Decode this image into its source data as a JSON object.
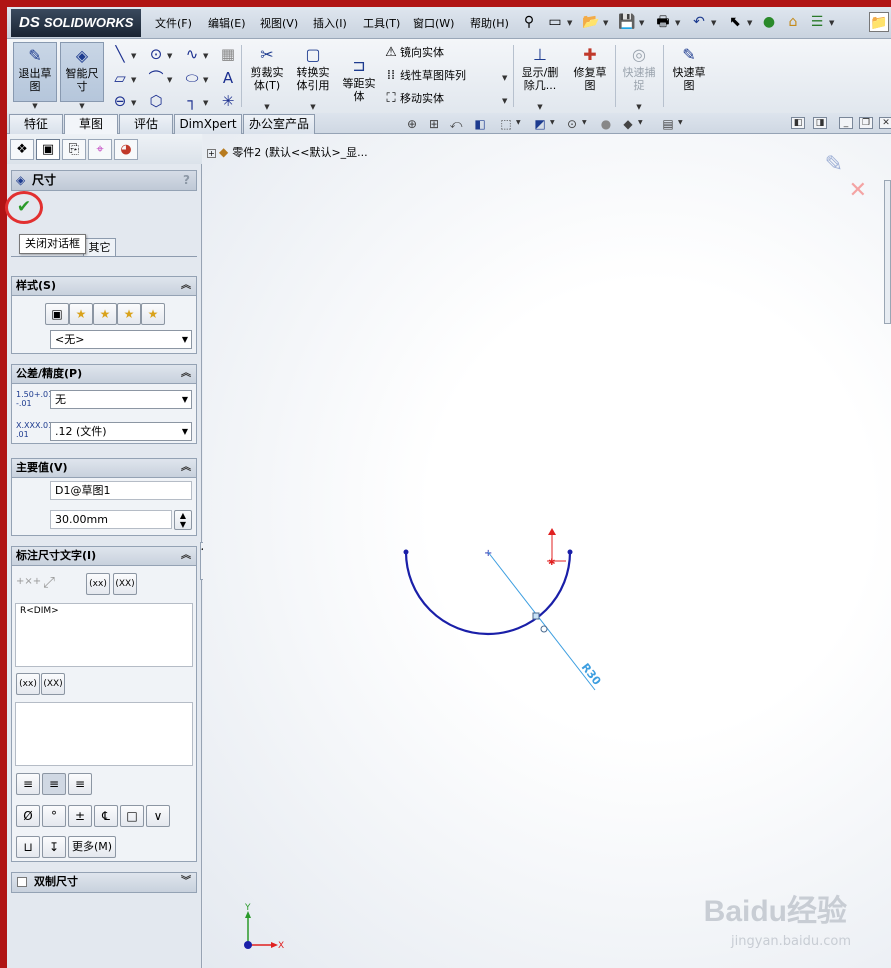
{
  "app": {
    "logo_prefix": "DS",
    "logo_text": "SOLIDWORKS"
  },
  "menu": [
    "文件(F)",
    "编辑(E)",
    "视图(V)",
    "插入(I)",
    "工具(T)",
    "窗口(W)",
    "帮助(H)"
  ],
  "command_manager": {
    "exit_sketch": "退出草\n图",
    "smart_dimension": "智能尺\n寸",
    "trim_entities": "剪裁实\n体(T)",
    "convert_entities": "转换实\n体引用",
    "offset_entities": "等距实\n体",
    "mirror_entities": "镜向实体",
    "linear_pattern": "线性草图阵列",
    "move_entities": "移动实体",
    "display_delete_relations": "显示/删\n除几...",
    "repair_sketch": "修复草\n图",
    "quick_snaps": "快速捕\n捉",
    "rapid_sketch": "快速草\n图"
  },
  "tabs": [
    "特征",
    "草图",
    "评估",
    "DimXpert",
    "办公室产品"
  ],
  "active_tab": "草图",
  "property_manager": {
    "title": "尺寸",
    "help": "?",
    "tooltip": "关闭对话框",
    "subtab": "其它",
    "style": {
      "header": "样式(S)",
      "favorite": "<无>"
    },
    "tolerance": {
      "header": "公差/精度(P)",
      "tolerance_icon_label": "1.50+.01\n-.01",
      "tolerance_type": "无",
      "precision_icon_label": "X.XXX.01\n.01",
      "precision": ".12 (文件)"
    },
    "primary_value": {
      "header": "主要值(V)",
      "name": "D1@草图1",
      "value": "30.00mm"
    },
    "dimension_text": {
      "header": "标注尺寸文字(I)",
      "btn_xx1": "(xx)",
      "btn_xx2": "(XX)",
      "text_top": "R<DIM>",
      "btn_xx3": "(xx)",
      "btn_xx4": "(XX)",
      "text_bottom": "",
      "more": "更多(M)"
    },
    "dual_dimension": {
      "header": "双制尺寸"
    }
  },
  "graphics": {
    "tree_label": "零件2 (默认<<默认>_显...",
    "dimension_label": "R30",
    "axis_x": "X",
    "axis_y": "Y"
  },
  "watermark": {
    "brand": "Baidu经验",
    "url": "jingyan.baidu.com"
  },
  "colors": {
    "frame": "#b01414",
    "sketch": "#1a1fa8",
    "dimension": "#3c9ee0",
    "origin_red": "#e02020"
  }
}
